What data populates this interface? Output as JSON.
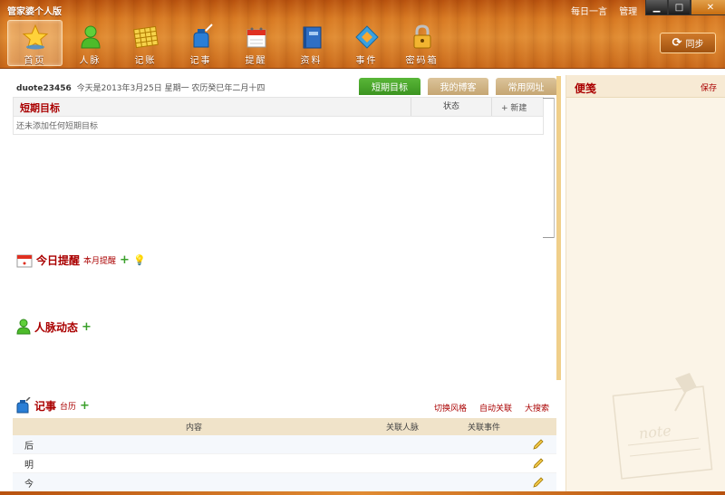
{
  "app": {
    "title": "管家婆个人版"
  },
  "top_links": [
    "每日一言",
    "管理"
  ],
  "window_controls": {
    "minimize": "▁",
    "maximize": "□",
    "close": "✕"
  },
  "nav": {
    "items": [
      {
        "label": "首页",
        "icon": "star-icon"
      },
      {
        "label": "人脉",
        "icon": "person-icon"
      },
      {
        "label": "记账",
        "icon": "abacus-icon"
      },
      {
        "label": "记事",
        "icon": "ink-bottle-icon"
      },
      {
        "label": "提醒",
        "icon": "calendar-icon"
      },
      {
        "label": "资料",
        "icon": "book-icon"
      },
      {
        "label": "事件",
        "icon": "diamond-icon"
      },
      {
        "label": "密码箱",
        "icon": "padlock-icon"
      }
    ],
    "active_index": 0
  },
  "sync": {
    "label": "同步",
    "icon": "refresh-icon"
  },
  "welcome": {
    "user": "duote23456",
    "text": "今天是2013年3月25日 星期一 农历癸巳年二月十四"
  },
  "tabs": [
    "短期目标",
    "我的博客",
    "常用网址"
  ],
  "goals": {
    "title": "短期目标",
    "status_col": "状态",
    "new_label": "+ 新建",
    "empty_text": "还未添加任何短期目标"
  },
  "reminders": {
    "title": "今日提醒",
    "sub": "本月提醒",
    "plus": "+",
    "bulb": "💡"
  },
  "contacts": {
    "title": "人脉动态",
    "plus": "+"
  },
  "notes": {
    "title": "记事",
    "sub": "台历",
    "plus": "+",
    "links": [
      "切换风格",
      "自动关联",
      "大搜索"
    ],
    "columns": [
      "内容",
      "关联人脉",
      "关联事件"
    ],
    "rows": [
      "后",
      "明",
      "今"
    ]
  },
  "sticky": {
    "title": "便笺",
    "save_label": "保存",
    "deco_text": "note"
  },
  "colors": {
    "accent_red": "#aa0000",
    "tab_active": "#4aa62d",
    "tab_inactive": "#d0b486",
    "wood": "#d87a23"
  }
}
